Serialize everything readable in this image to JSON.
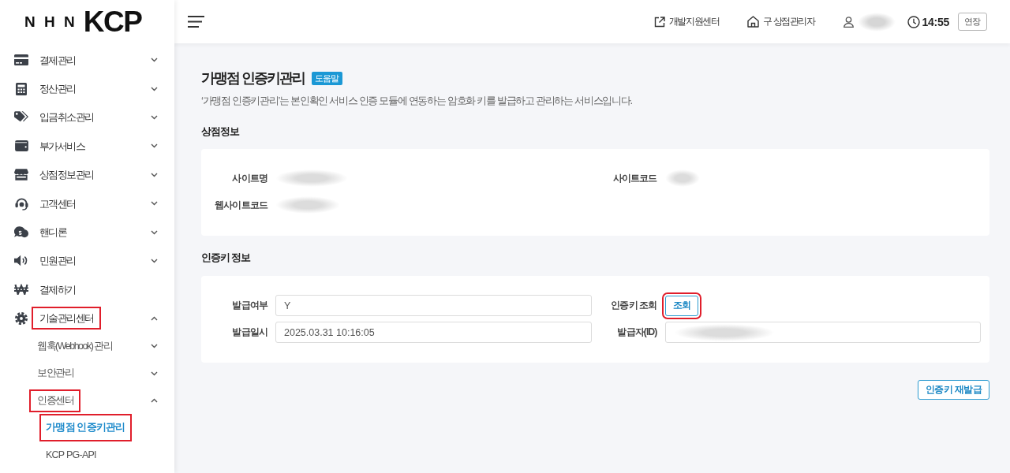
{
  "logo": {
    "prefix": "N H N",
    "name": "KCP"
  },
  "sidebar": {
    "items": [
      {
        "label": "결제관리",
        "expandable": true,
        "expanded": false,
        "selected": false,
        "highlighted": false
      },
      {
        "label": "정산관리",
        "expandable": true,
        "expanded": false,
        "selected": false,
        "highlighted": false
      },
      {
        "label": "입금취소관리",
        "expandable": true,
        "expanded": false,
        "selected": false,
        "highlighted": false
      },
      {
        "label": "부가서비스",
        "expandable": true,
        "expanded": false,
        "selected": false,
        "highlighted": false
      },
      {
        "label": "상점정보관리",
        "expandable": true,
        "expanded": false,
        "selected": false,
        "highlighted": false
      },
      {
        "label": "고객센터",
        "expandable": true,
        "expanded": false,
        "selected": false,
        "highlighted": false
      },
      {
        "label": "핸디론",
        "expandable": true,
        "expanded": false,
        "selected": false,
        "highlighted": false
      },
      {
        "label": "민원관리",
        "expandable": true,
        "expanded": false,
        "selected": false,
        "highlighted": false
      },
      {
        "label": "결제하기",
        "expandable": false,
        "selected": false,
        "highlighted": false
      },
      {
        "label": "기술관리센터",
        "expandable": true,
        "expanded": true,
        "selected": false,
        "highlighted": true,
        "children": [
          {
            "label": "웹훅(Webhook) 관리",
            "expandable": true,
            "expanded": false,
            "selected": false,
            "highlighted": false
          },
          {
            "label": "보안관리",
            "expandable": true,
            "expanded": false,
            "selected": false,
            "highlighted": false
          },
          {
            "label": "인증센터",
            "expandable": true,
            "expanded": true,
            "selected": false,
            "highlighted": true,
            "children": [
              {
                "label": "가맹점 인증키관리",
                "selected": true,
                "highlighted": true
              },
              {
                "label": "KCP PG-API",
                "selected": false,
                "highlighted": false
              }
            ]
          }
        ]
      }
    ]
  },
  "header": {
    "links": [
      {
        "label": "개발지원센터"
      },
      {
        "label": "구 상점관리자"
      }
    ],
    "user": {
      "name_blurred": true
    },
    "session_time": "14:55",
    "extend_button": "연장"
  },
  "page": {
    "title": "가맹점 인증키관리",
    "help_badge": "도움말",
    "description": "‘가맹점 인증키관리’는 본인확인 서비스 인증 모듈에 연동하는 암호화 키를 발급하고 관리하는 서비스입니다.",
    "sections": [
      {
        "heading": "상점정보",
        "fields": [
          {
            "label": "사이트명",
            "kind": "text",
            "blurred": true
          },
          {
            "label": "사이트코드",
            "kind": "text",
            "blurred": true
          },
          {
            "label": "웹사이트코드",
            "kind": "text",
            "blurred": true
          }
        ]
      },
      {
        "heading": "인증키 정보",
        "fields": [
          {
            "label": "발급여부",
            "kind": "input",
            "value": "Y",
            "blurred": false
          },
          {
            "label": "인증키 조회",
            "kind": "button",
            "button": "조회",
            "highlighted": true
          },
          {
            "label": "발급일시",
            "kind": "input",
            "value": "2025.03.31 10:16:05",
            "blurred": false
          },
          {
            "label": "발급자(ID)",
            "kind": "input",
            "blurred": true
          }
        ]
      }
    ],
    "reissue_button": "인증키 재발급"
  }
}
